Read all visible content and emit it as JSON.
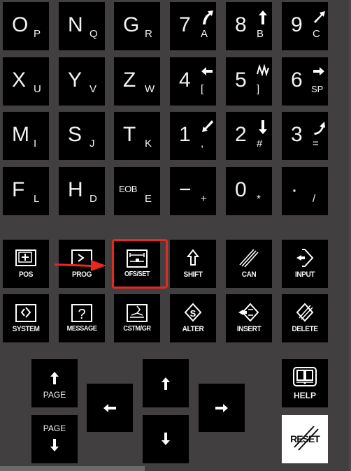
{
  "keypad": {
    "rows": [
      [
        {
          "main": "O",
          "sub": "P"
        },
        {
          "main": "N",
          "sub": "Q"
        },
        {
          "main": "G",
          "sub": "R"
        },
        {
          "main": "7",
          "sub": "A",
          "icon": "curve-up-left-arrow-icon"
        },
        {
          "main": "8",
          "sub": "B",
          "icon": "up-arrow-icon"
        },
        {
          "main": "9",
          "sub": "C",
          "icon": "diagonal-up-right-arrow-icon"
        }
      ],
      [
        {
          "main": "X",
          "sub": "U"
        },
        {
          "main": "Y",
          "sub": "V"
        },
        {
          "main": "Z",
          "sub": "W"
        },
        {
          "main": "4",
          "sub": "[",
          "icon": "left-arrow-icon"
        },
        {
          "main": "5",
          "sub": "]",
          "icon": "zigzag-icon"
        },
        {
          "main": "6",
          "sub": "SP",
          "icon": "right-arrow-icon"
        }
      ],
      [
        {
          "main": "M",
          "sub": "I"
        },
        {
          "main": "S",
          "sub": "J"
        },
        {
          "main": "T",
          "sub": "K"
        },
        {
          "main": "1",
          "sub": ",",
          "icon": "diagonal-down-left-arrow-icon"
        },
        {
          "main": "2",
          "sub": "#",
          "icon": "down-arrow-icon"
        },
        {
          "main": "3",
          "sub": "=",
          "icon": "curve-down-right-arrow-icon"
        }
      ],
      [
        {
          "main": "F",
          "sub": "L"
        },
        {
          "main": "H",
          "sub": "D"
        },
        {
          "main": "EOB",
          "sub": "E"
        },
        {
          "main": "−",
          "sub": "+"
        },
        {
          "main": "0",
          "sub": "*"
        },
        {
          "main": "·",
          "sub": "/"
        }
      ]
    ]
  },
  "function_keys": {
    "row1": [
      {
        "label": "POS",
        "icon": "position-icon"
      },
      {
        "label": "PROG",
        "icon": "program-icon"
      },
      {
        "label": "OFS/SET",
        "icon": "offset-setting-icon"
      },
      {
        "label": "SHIFT",
        "icon": "shift-arrow-icon"
      },
      {
        "label": "CAN",
        "icon": "cancel-slash-icon"
      },
      {
        "label": "INPUT",
        "icon": "input-icon"
      }
    ],
    "row2": [
      {
        "label": "SYSTEM",
        "icon": "system-icon"
      },
      {
        "label": "MESSAGE",
        "icon": "message-icon"
      },
      {
        "label": "CSTM/GR",
        "icon": "custom-graph-icon"
      },
      {
        "label": "ALTER",
        "icon": "alter-icon"
      },
      {
        "label": "INSERT",
        "icon": "insert-icon"
      },
      {
        "label": "DELETE",
        "icon": "delete-icon"
      }
    ]
  },
  "navigation": {
    "page_up": "PAGE",
    "page_down": "PAGE",
    "help": "HELP",
    "reset": "RESET"
  },
  "annotation": {
    "highlighted_key": "OFS/SET",
    "color": "#e8281f"
  },
  "colors": {
    "background": "#423f40",
    "key": "#000000",
    "key_text": "#f2f2f2",
    "reset_key": "#ffffff"
  }
}
